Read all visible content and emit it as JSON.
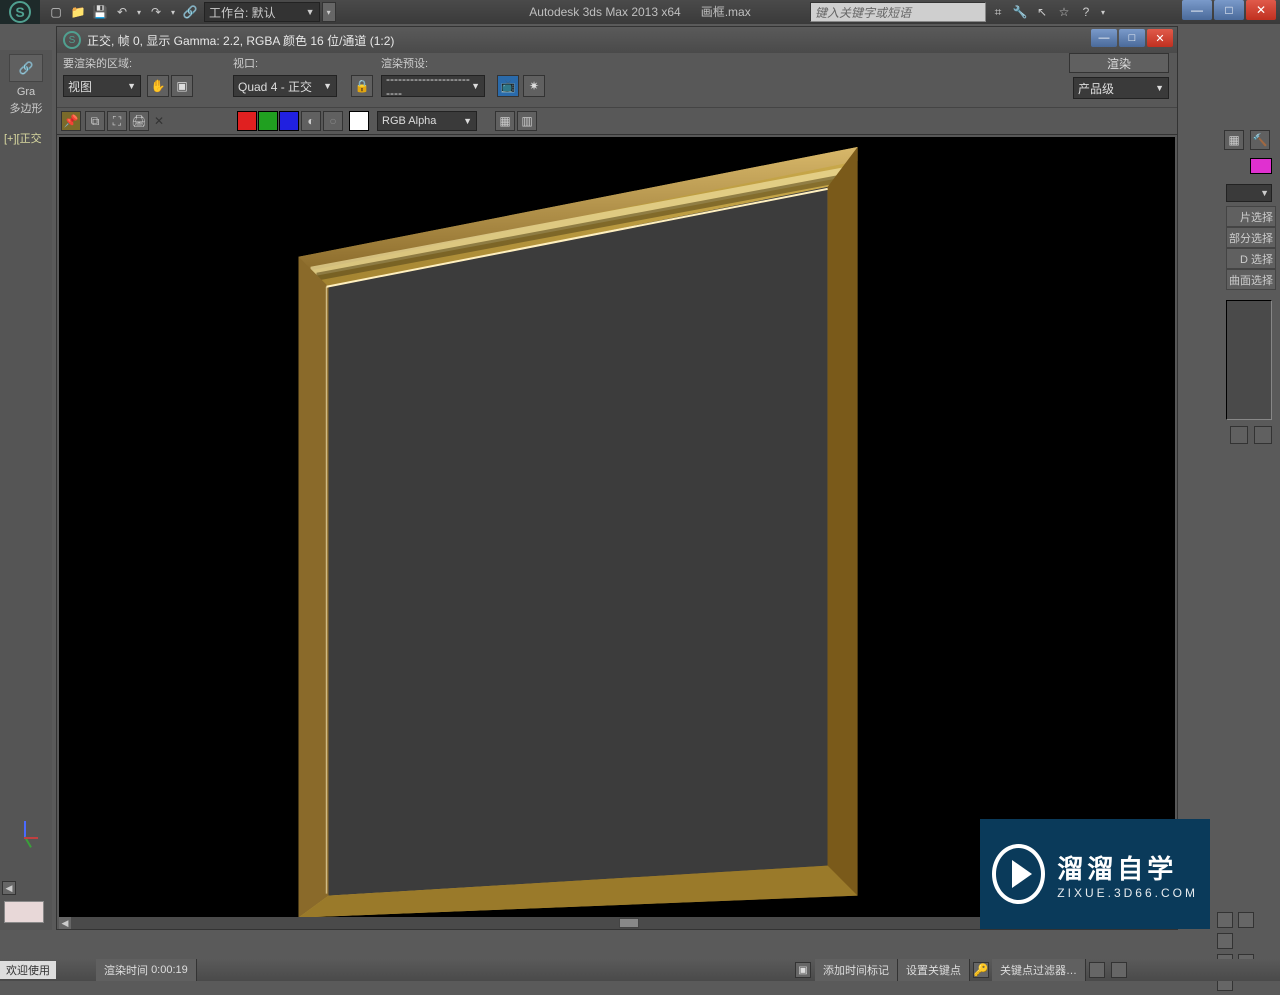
{
  "app": {
    "title_left": "Autodesk 3ds Max  2013 x64",
    "filename": "画框.max",
    "workspace_label": "工作台: 默认",
    "search_placeholder": "键入关键字或短语",
    "open_file_glyph": "📁",
    "save_glyph": "💾",
    "undo_glyph": "↶",
    "redo_glyph": "↷",
    "link_glyph": "🔗"
  },
  "win_sys": {
    "min": "—",
    "max": "□",
    "close": "✕"
  },
  "left_strip": {
    "link_icon": "🔗",
    "tab_label_top": "Gra",
    "tab_label_bottom": "多边形",
    "viewport_label": "[+][正交"
  },
  "right_panel": {
    "items": [
      "片选择",
      "部分选择",
      "D 选择",
      "曲面选择"
    ]
  },
  "rfw": {
    "title": "正交, 帧 0, 显示 Gamma: 2.2, RGBA 颜色 16 位/通道 (1:2)",
    "labels": {
      "area": "要渲染的区域:",
      "viewport": "视口:",
      "preset": "渲染预设:"
    },
    "area_value": "视图",
    "viewport_value": "Quad 4 - 正交",
    "preset_value": "-------------------------",
    "production_value": "产品级",
    "render_btn": "渲染",
    "channel_value": "RGB Alpha",
    "lock_glyph": "🔒",
    "pin_glyph": "📌",
    "copy_glyph": "⧉",
    "clone_glyph": "⛶",
    "print_glyph": "🖨",
    "del_glyph": "✕",
    "mono_glyph": "◐",
    "alpha_glyph": "○",
    "swatch_glyph": "■",
    "safe_glyph": "▦",
    "toggle_glyph": "▥",
    "tv_glyph": "📺",
    "gear_glyph": "✷"
  },
  "status": {
    "welcome": "欢迎使用",
    "render_time_label": "渲染时间",
    "render_time_value": "0:00:19",
    "add_time_tag": "添加时间标记",
    "set_keypoint": "设置关键点",
    "key_filter": "关键点过滤器…"
  },
  "logo": {
    "line1": "溜溜自学",
    "line2": "ZIXUE.3D66.COM"
  }
}
